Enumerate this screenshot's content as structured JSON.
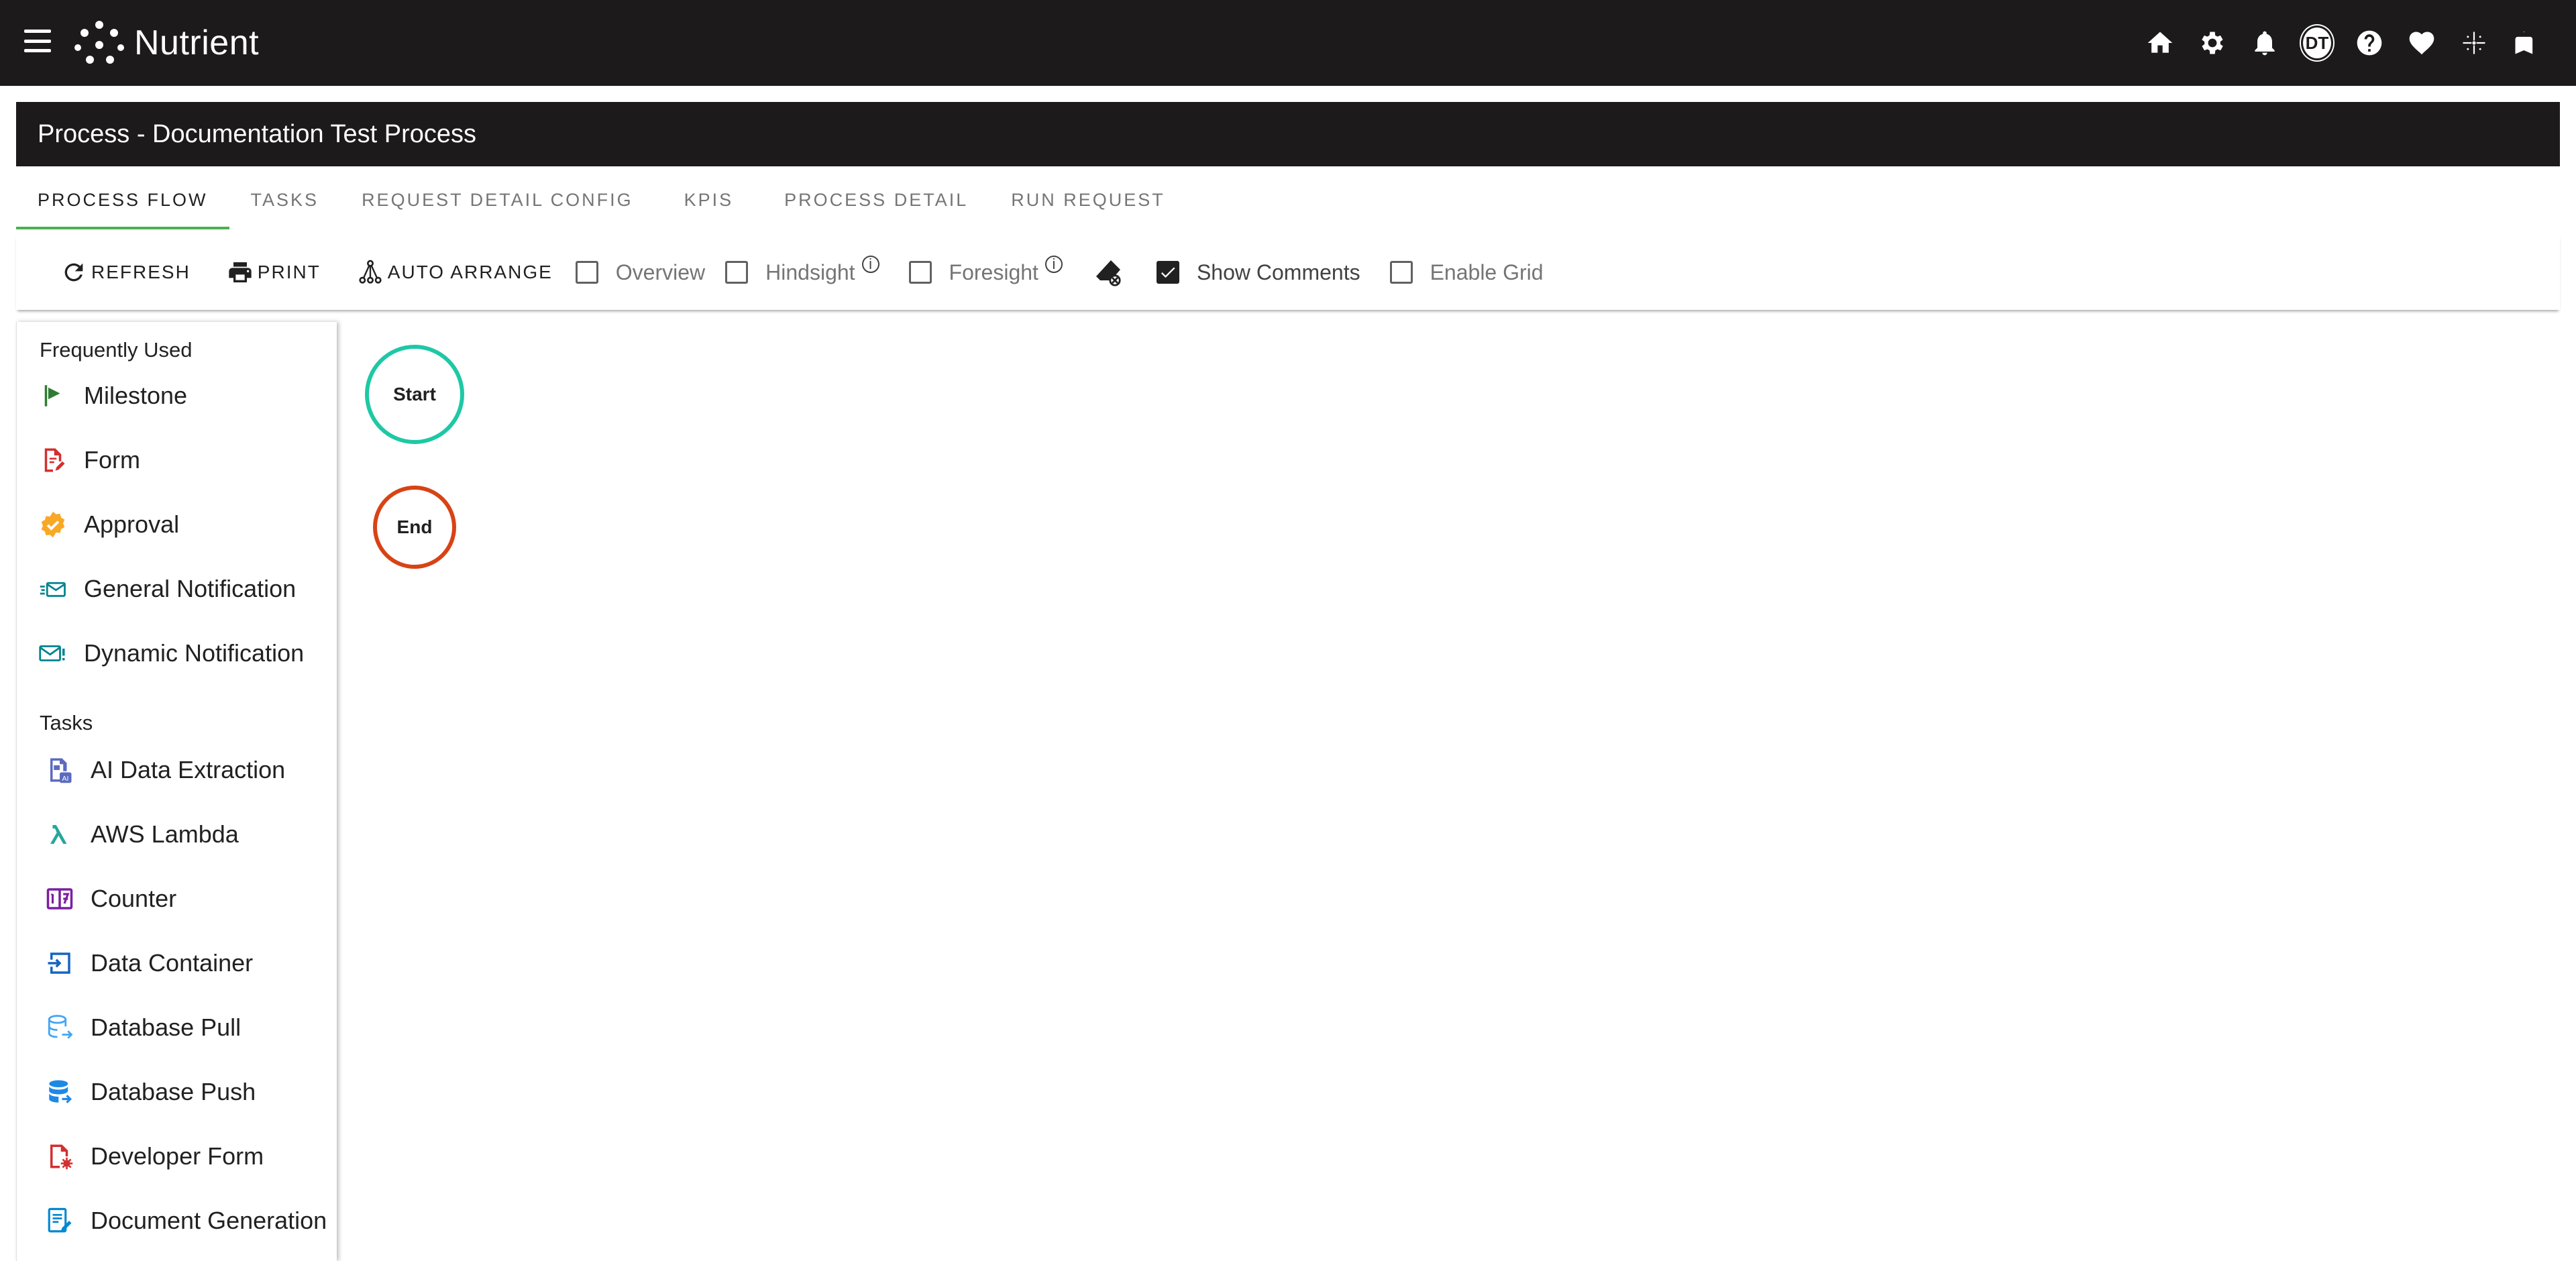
{
  "app": {
    "name": "Nutrient"
  },
  "topbar": {
    "icons": [
      "home-icon",
      "settings-gear-icon",
      "notifications-bell-icon",
      "avatar",
      "help-icon",
      "favorites-heart-icon",
      "sparkle-icon",
      "bookmarks-icon"
    ],
    "avatar_initials": "DT"
  },
  "page": {
    "title": "Process - Documentation Test Process"
  },
  "tabs": [
    {
      "label": "PROCESS FLOW",
      "active": true
    },
    {
      "label": "TASKS"
    },
    {
      "label": "REQUEST DETAIL CONFIG"
    },
    {
      "label": "KPIS"
    },
    {
      "label": "PROCESS DETAIL"
    },
    {
      "label": "RUN REQUEST"
    }
  ],
  "toolbar": {
    "refresh": "REFRESH",
    "print": "PRINT",
    "auto_arrange": "AUTO ARRANGE",
    "overview": {
      "label": "Overview",
      "checked": false
    },
    "hindsight": {
      "label": "Hindsight",
      "checked": false
    },
    "foresight": {
      "label": "Foresight",
      "checked": false
    },
    "show_comments": {
      "label": "Show Comments",
      "checked": true
    },
    "enable_grid": {
      "label": "Enable Grid",
      "checked": false
    }
  },
  "palette": {
    "frequently_used_title": "Frequently Used",
    "frequently_used": [
      {
        "label": "Milestone",
        "icon": "milestone-flag-icon",
        "color": "#2e7d32"
      },
      {
        "label": "Form",
        "icon": "form-icon",
        "color": "#d32f2f"
      },
      {
        "label": "Approval",
        "icon": "approval-badge-icon",
        "color": "#f9a825"
      },
      {
        "label": "General Notification",
        "icon": "general-notification-icon",
        "color": "#00838f"
      },
      {
        "label": "Dynamic Notification",
        "icon": "dynamic-notification-icon",
        "color": "#00838f"
      }
    ],
    "tasks_title": "Tasks",
    "tasks": [
      {
        "label": "AI Data Extraction",
        "icon": "ai-data-extraction-icon",
        "color": "#5c6bc0"
      },
      {
        "label": "AWS Lambda",
        "icon": "lambda-icon",
        "color": "#26a69a"
      },
      {
        "label": "Counter",
        "icon": "counter-icon",
        "color": "#7b1fa2"
      },
      {
        "label": "Data Container",
        "icon": "data-container-icon",
        "color": "#1565c0"
      },
      {
        "label": "Database Pull",
        "icon": "database-pull-icon",
        "color": "#42a5f5"
      },
      {
        "label": "Database Push",
        "icon": "database-push-icon",
        "color": "#1e88e5"
      },
      {
        "label": "Developer Form",
        "icon": "developer-form-icon",
        "color": "#d32f2f"
      },
      {
        "label": "Document Generation",
        "icon": "document-generation-icon",
        "color": "#0288d1"
      }
    ]
  },
  "canvas": {
    "start": {
      "label": "Start",
      "color": "#1ec8a5"
    },
    "end": {
      "label": "End",
      "color": "#d84315"
    }
  }
}
